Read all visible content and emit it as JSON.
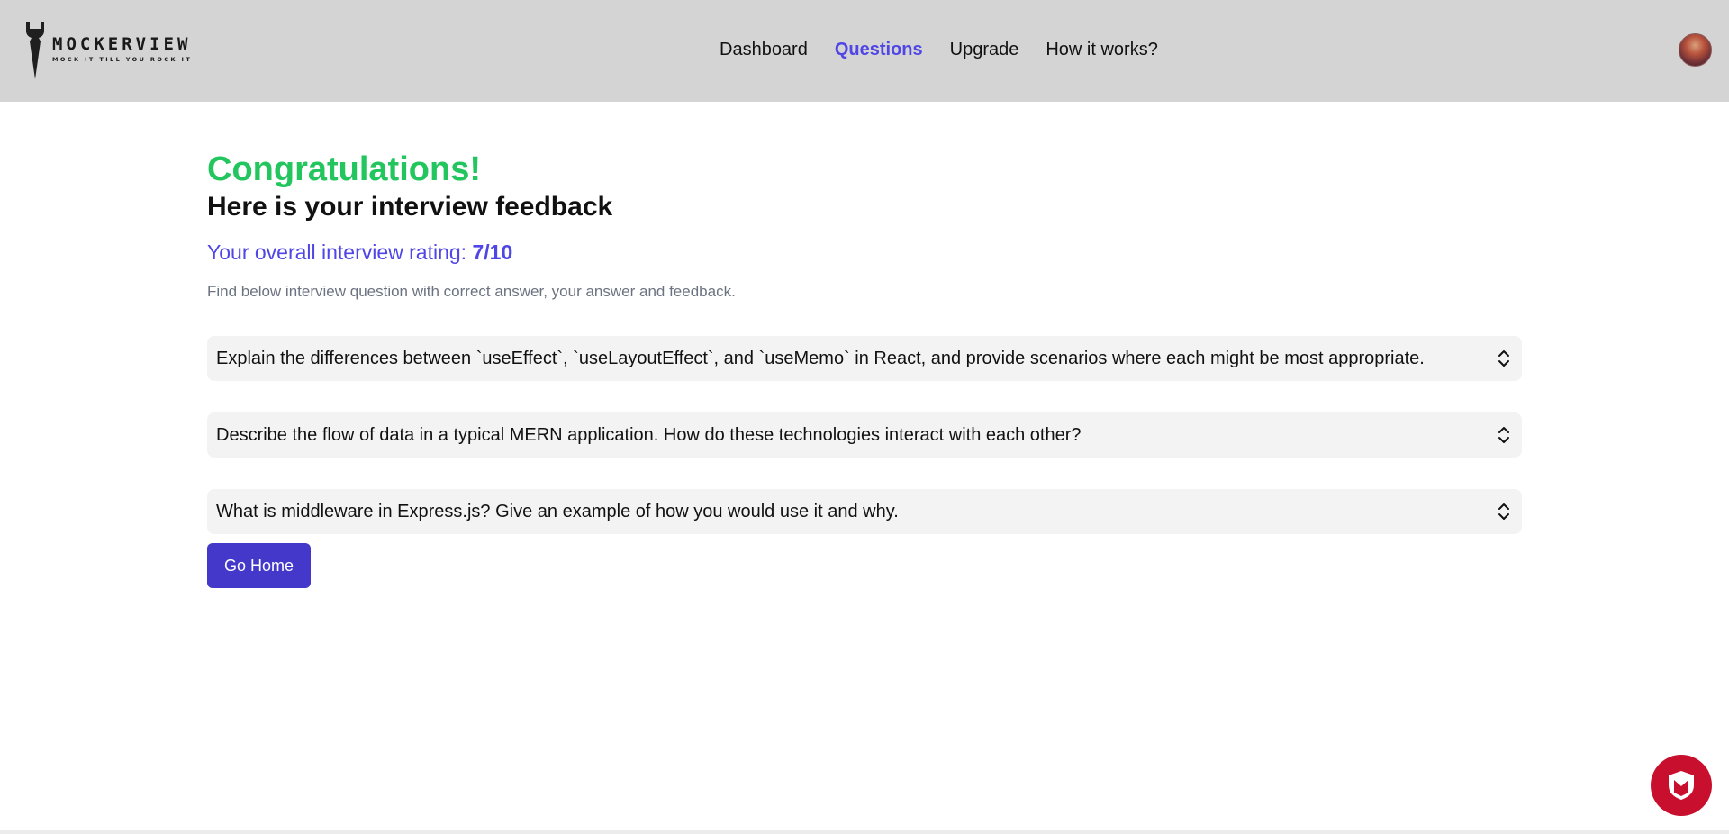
{
  "brand": {
    "name": "MOCKERVIEW",
    "tagline": "MOCK IT TILL YOU ROCK IT"
  },
  "nav": {
    "items": [
      {
        "label": "Dashboard",
        "active": false
      },
      {
        "label": "Questions",
        "active": true
      },
      {
        "label": "Upgrade",
        "active": false
      },
      {
        "label": "How it works?",
        "active": false
      }
    ]
  },
  "user": {
    "avatar_icon": "user-avatar-icon"
  },
  "feedback": {
    "title": "Congratulations!",
    "subtitle": "Here is your interview feedback",
    "rating_label": "Your overall interview rating: ",
    "rating_value": "7/10",
    "hint": "Find below interview question with correct answer, your answer and feedback."
  },
  "questions": [
    {
      "text": "Explain the differences between `useEffect`, `useLayoutEffect`, and `useMemo` in React, and provide scenarios where each might be most appropriate.",
      "expanded": false
    },
    {
      "text": "Describe the flow of data in a typical MERN application. How do these technologies interact with each other?",
      "expanded": false
    },
    {
      "text": "What is middleware in Express.js? Give an example of how you would use it and why.",
      "expanded": false
    }
  ],
  "actions": {
    "home_label": "Go Home"
  },
  "colors": {
    "accent": "#4f46e5",
    "success": "#22c55e",
    "button": "#4338ca",
    "header_bg": "#d4d4d4",
    "shield": "#c8102e"
  }
}
